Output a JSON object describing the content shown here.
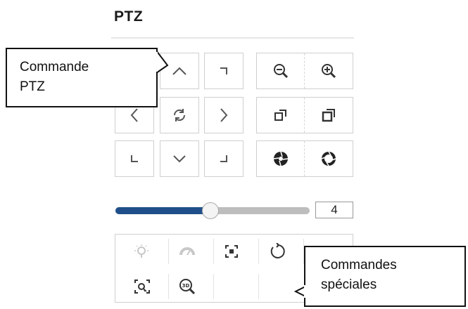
{
  "panel": {
    "title": "PTZ"
  },
  "direction_pad": {
    "up_icon": "chevron-up-icon",
    "up_right_icon": "corner-up-right-icon",
    "left_icon": "chevron-left-icon",
    "auto_icon": "rotate-icon",
    "right_icon": "chevron-right-icon",
    "down_left_icon": "corner-down-left-icon",
    "down_icon": "chevron-down-icon",
    "down_right_icon": "corner-down-right-icon"
  },
  "lens_controls": {
    "zoom_out_icon": "zoom-out-icon",
    "zoom_in_icon": "zoom-in-icon",
    "focus_near_icon": "focus-near-icon",
    "focus_far_icon": "focus-far-icon",
    "iris_close_icon": "iris-close-icon",
    "iris_open_icon": "iris-open-icon"
  },
  "speed": {
    "value": "4",
    "level": 4,
    "max": 7
  },
  "special_commands": [
    "light-icon",
    "wiper-icon",
    "one-touch-focus-icon",
    "lens-reset-icon",
    "manual-tracking-icon",
    "3d-zoom-icon"
  ],
  "callouts": {
    "ptz_line1": "Commande",
    "ptz_line2": "PTZ",
    "special_line1": "Commandes",
    "special_line2": "spéciales"
  },
  "colors": {
    "slider_fill": "#1f4f8a",
    "slider_track": "#bdbdbd",
    "border": "#cfcfcf"
  }
}
